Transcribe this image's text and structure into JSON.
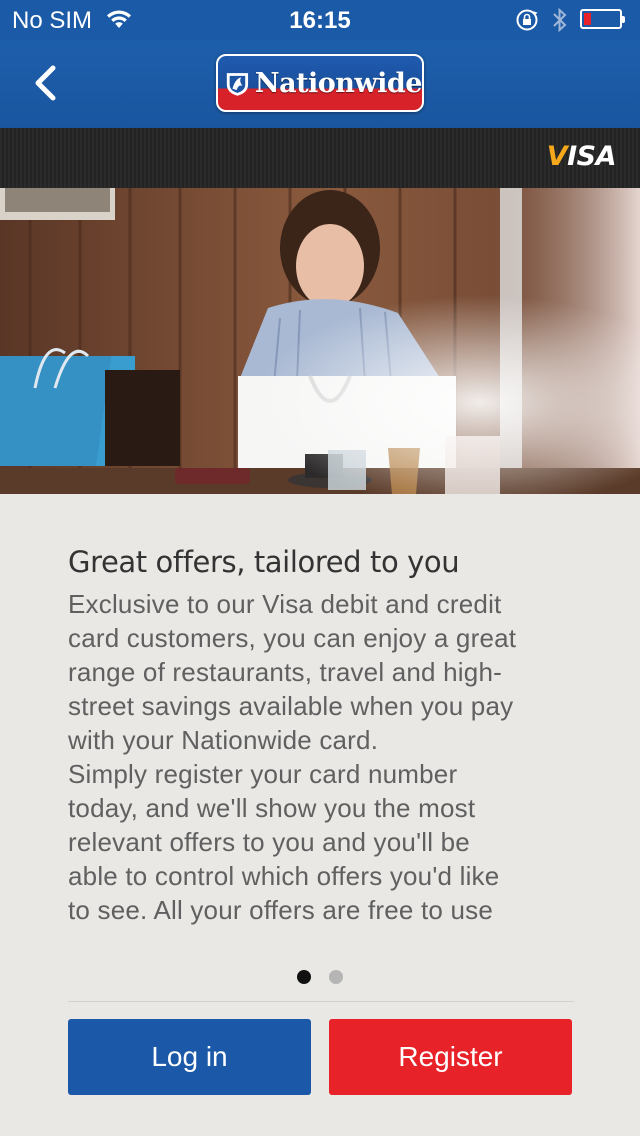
{
  "status_bar": {
    "carrier": "No SIM",
    "time": "16:15",
    "battery_level": 0.2
  },
  "nav": {
    "logo_text": "Nationwide"
  },
  "card_strip": {
    "brand": "VISA"
  },
  "content": {
    "headline": "Great offers, tailored to you",
    "body": "Exclusive to our Visa debit and credit card customers, you can enjoy a great range of restaurants, travel and high-street savings available when you pay with your Nationwide card.\nSimply register your card number today, and we'll show you the most relevant offers to you and you'll be able to control which offers you'd like to see. All your offers are free to use"
  },
  "pager": {
    "count": 2,
    "active_index": 0
  },
  "buttons": {
    "login_label": "Log in",
    "register_label": "Register"
  },
  "colors": {
    "brand_blue": "#1b58a7",
    "brand_red": "#e72228",
    "visa_gold": "#f6a81c"
  },
  "icons": [
    "wifi-icon",
    "orientation-lock-icon",
    "bluetooth-icon",
    "battery-icon",
    "back-chevron-icon",
    "nationwide-logo-icon"
  ]
}
